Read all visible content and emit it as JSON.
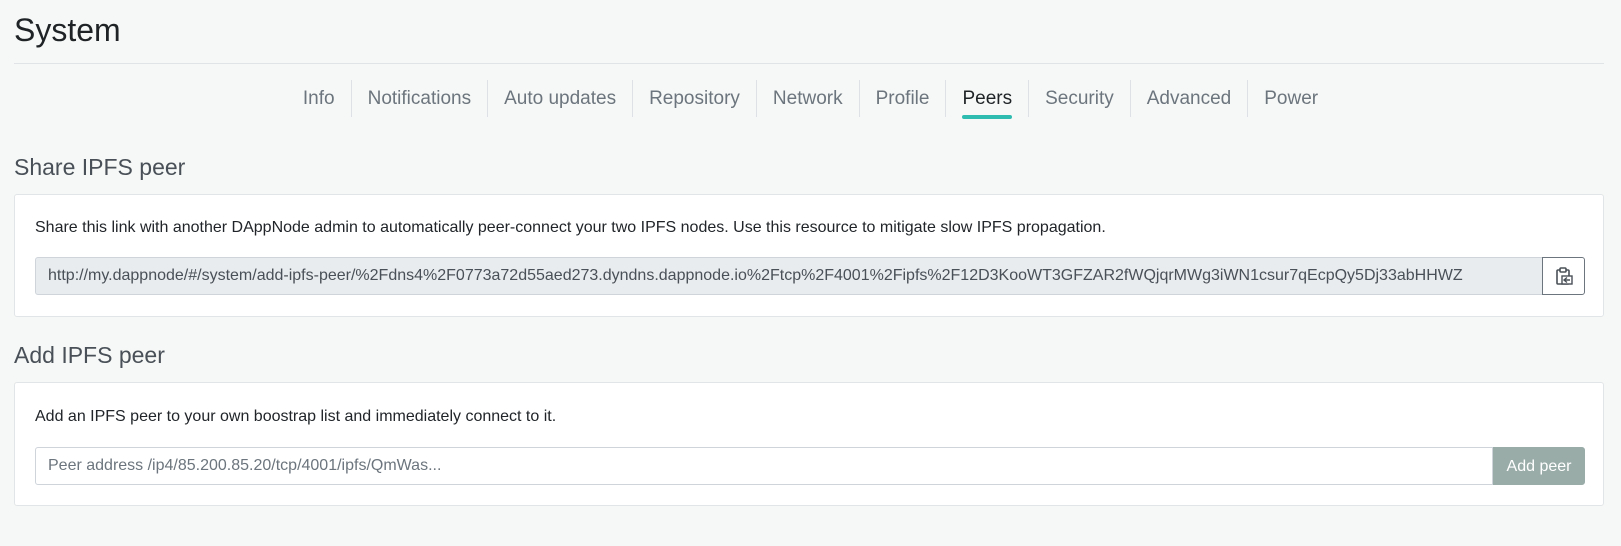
{
  "page": {
    "title": "System"
  },
  "tabs": [
    {
      "label": "Info",
      "active": false
    },
    {
      "label": "Notifications",
      "active": false
    },
    {
      "label": "Auto updates",
      "active": false
    },
    {
      "label": "Repository",
      "active": false
    },
    {
      "label": "Network",
      "active": false
    },
    {
      "label": "Profile",
      "active": false
    },
    {
      "label": "Peers",
      "active": true
    },
    {
      "label": "Security",
      "active": false
    },
    {
      "label": "Advanced",
      "active": false
    },
    {
      "label": "Power",
      "active": false
    }
  ],
  "share_section": {
    "title": "Share IPFS peer",
    "description": "Share this link with another DAppNode admin to automatically peer-connect your two IPFS nodes. Use this resource to mitigate slow IPFS propagation.",
    "link_value": "http://my.dappnode/#/system/add-ipfs-peer/%2Fdns4%2F0773a72d55aed273.dyndns.dappnode.io%2Ftcp%2F4001%2Fipfs%2F12D3KooWT3GFZAR2fWQjqrMWg3iWN1csur7qEcpQy5Dj33abHHWZ",
    "copy_icon": "clipboard-copy-icon"
  },
  "add_section": {
    "title": "Add IPFS peer",
    "description": "Add an IPFS peer to your own boostrap list and immediately connect to it.",
    "input_placeholder": "Peer address /ip4/85.200.85.20/tcp/4001/ipfs/QmWas...",
    "input_value": "",
    "button_label": "Add peer"
  },
  "colors": {
    "accent": "#2fbcb0",
    "background": "#f6f8f7",
    "button_disabled": "#99aca8"
  }
}
